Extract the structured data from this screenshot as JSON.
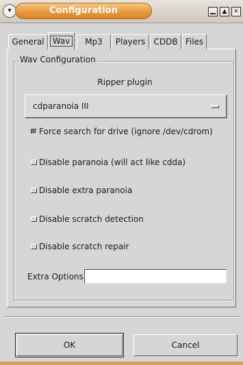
{
  "window": {
    "title": "Configuration",
    "menu_glyph": "▾",
    "controls": {
      "minimize": "",
      "maximize": "▲",
      "close": "✕"
    }
  },
  "tabs": [
    {
      "label": "General",
      "active": false
    },
    {
      "label": "Wav",
      "active": true
    },
    {
      "label": "Mp3",
      "active": false
    },
    {
      "label": "Players",
      "active": false
    },
    {
      "label": "CDDB",
      "active": false
    },
    {
      "label": "Files",
      "active": false
    }
  ],
  "wav": {
    "frame_label": "Wav Configuration",
    "ripper_label": "Ripper plugin",
    "ripper_value": "cdparanoia III",
    "options": [
      {
        "label": "Force search for drive (ignore /dev/cdrom)",
        "checked": true
      },
      {
        "label": "Disable paranoia (will act like cdda)",
        "checked": false
      },
      {
        "label": "Disable extra paranoia",
        "checked": false
      },
      {
        "label": "Disable scratch detection",
        "checked": false
      },
      {
        "label": "Disable scratch repair",
        "checked": false
      }
    ],
    "extra_options_label": "Extra Options:",
    "extra_options_value": ""
  },
  "buttons": {
    "ok": "OK",
    "cancel": "Cancel"
  }
}
